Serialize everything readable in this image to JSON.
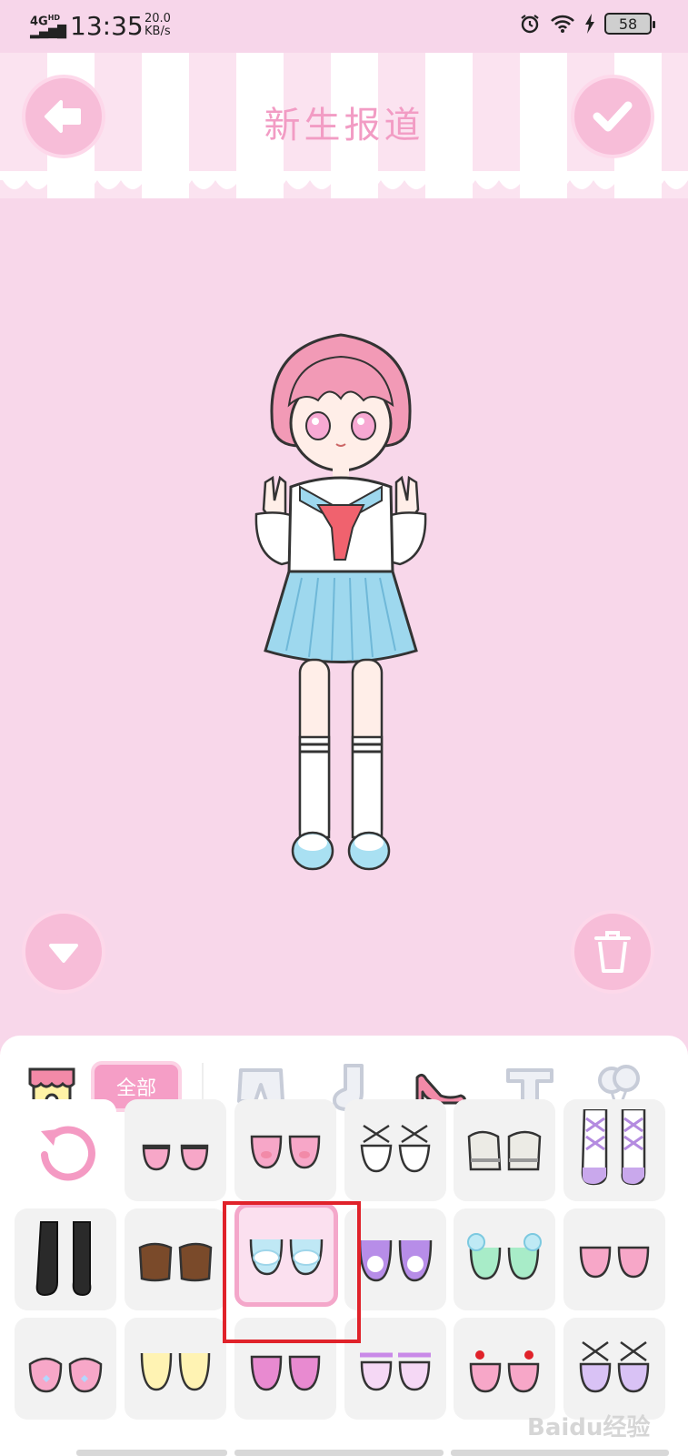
{
  "status_bar": {
    "network": "4G",
    "network_sub": "HD",
    "time": "13:35",
    "speed_value": "20.0",
    "speed_unit": "KB/s",
    "battery": "58"
  },
  "header": {
    "title": "新生报道",
    "back_icon": "arrow-left-icon",
    "confirm_icon": "check-icon"
  },
  "controls": {
    "collapse_icon": "triangle-down-icon",
    "delete_icon": "trash-icon"
  },
  "categories": {
    "all_label": "全部",
    "items": [
      "shop-icon",
      "shorts-icon",
      "sock-icon",
      "heel-shoe-icon",
      "tshirt-icon",
      "balloon-icon"
    ],
    "active": "heel-shoe-icon"
  },
  "shoes": {
    "selected": "blue-fluffy-slippers",
    "items": [
      "reset",
      "pink-strap-shoes",
      "pink-pig-slippers",
      "white-cross-shoes",
      "grey-sneakers",
      "lavender-boots",
      "black-tall-boots",
      "brown-loafers",
      "blue-fluffy-slippers",
      "purple-pompom-flats",
      "mint-pompom-flats",
      "pink-star-flats",
      "pink-heart-shoes",
      "yellow-heart-flats",
      "pink-bow-flats",
      "lilac-ribbon-flats",
      "cherry-shoes",
      "purple-cross-shoes"
    ]
  },
  "colors": {
    "background": "#f8d7ea",
    "accent": "#f59ec6",
    "highlight": "#e0222a"
  },
  "watermark": "Baidu经验"
}
